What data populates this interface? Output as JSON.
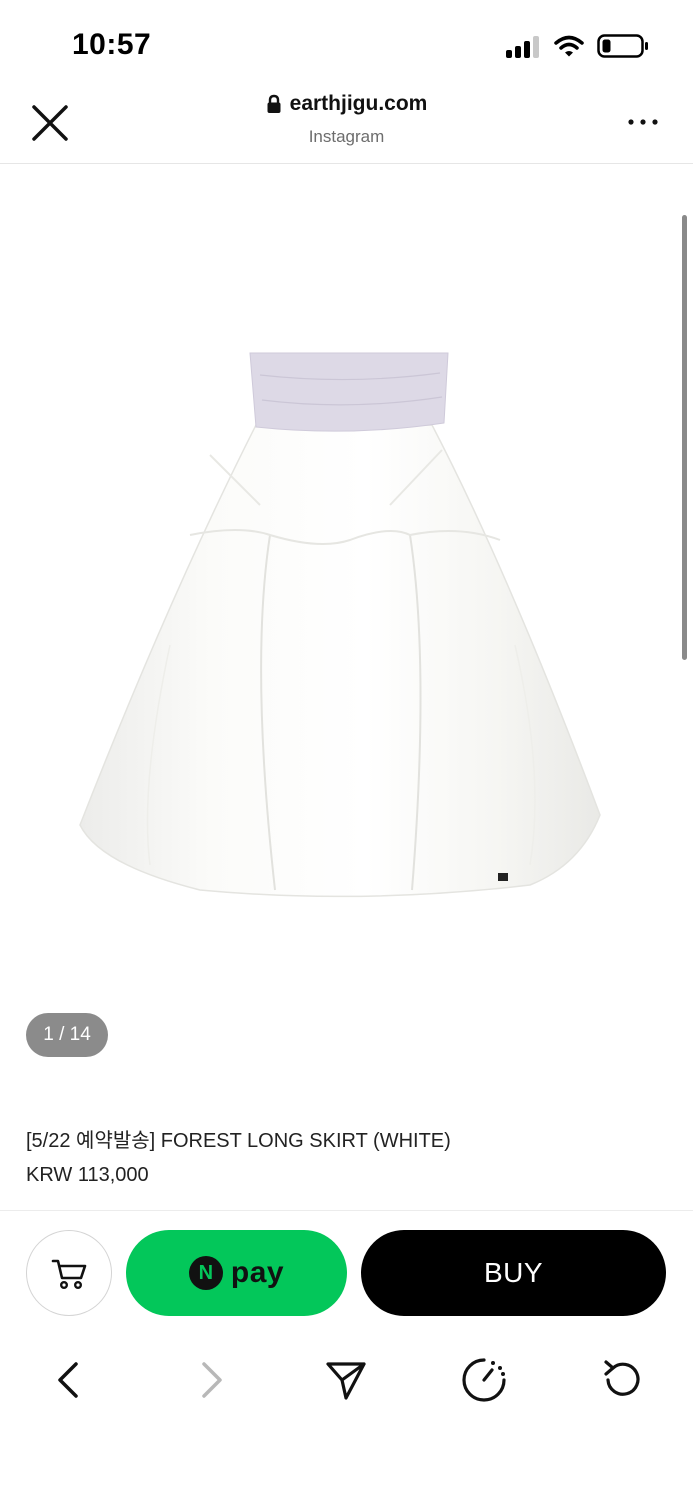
{
  "status_bar": {
    "time": "10:57"
  },
  "browser": {
    "domain": "earthjigu.com",
    "source": "Instagram",
    "icons": [
      "close-icon",
      "lock-icon",
      "more-icon"
    ]
  },
  "product": {
    "image_counter": "1 / 14",
    "title": "[5/22 예약발송] FOREST LONG SKIRT (WHITE)",
    "price": "KRW 113,000"
  },
  "purchase_bar": {
    "npay_badge": "N",
    "npay_label": "pay",
    "buy_label": "BUY",
    "colors": {
      "npay": "#03c75a",
      "buy": "#000000"
    }
  },
  "bottom_nav": {
    "icons": [
      "back-icon",
      "forward-icon",
      "share-icon",
      "speed-icon",
      "reload-icon"
    ]
  }
}
